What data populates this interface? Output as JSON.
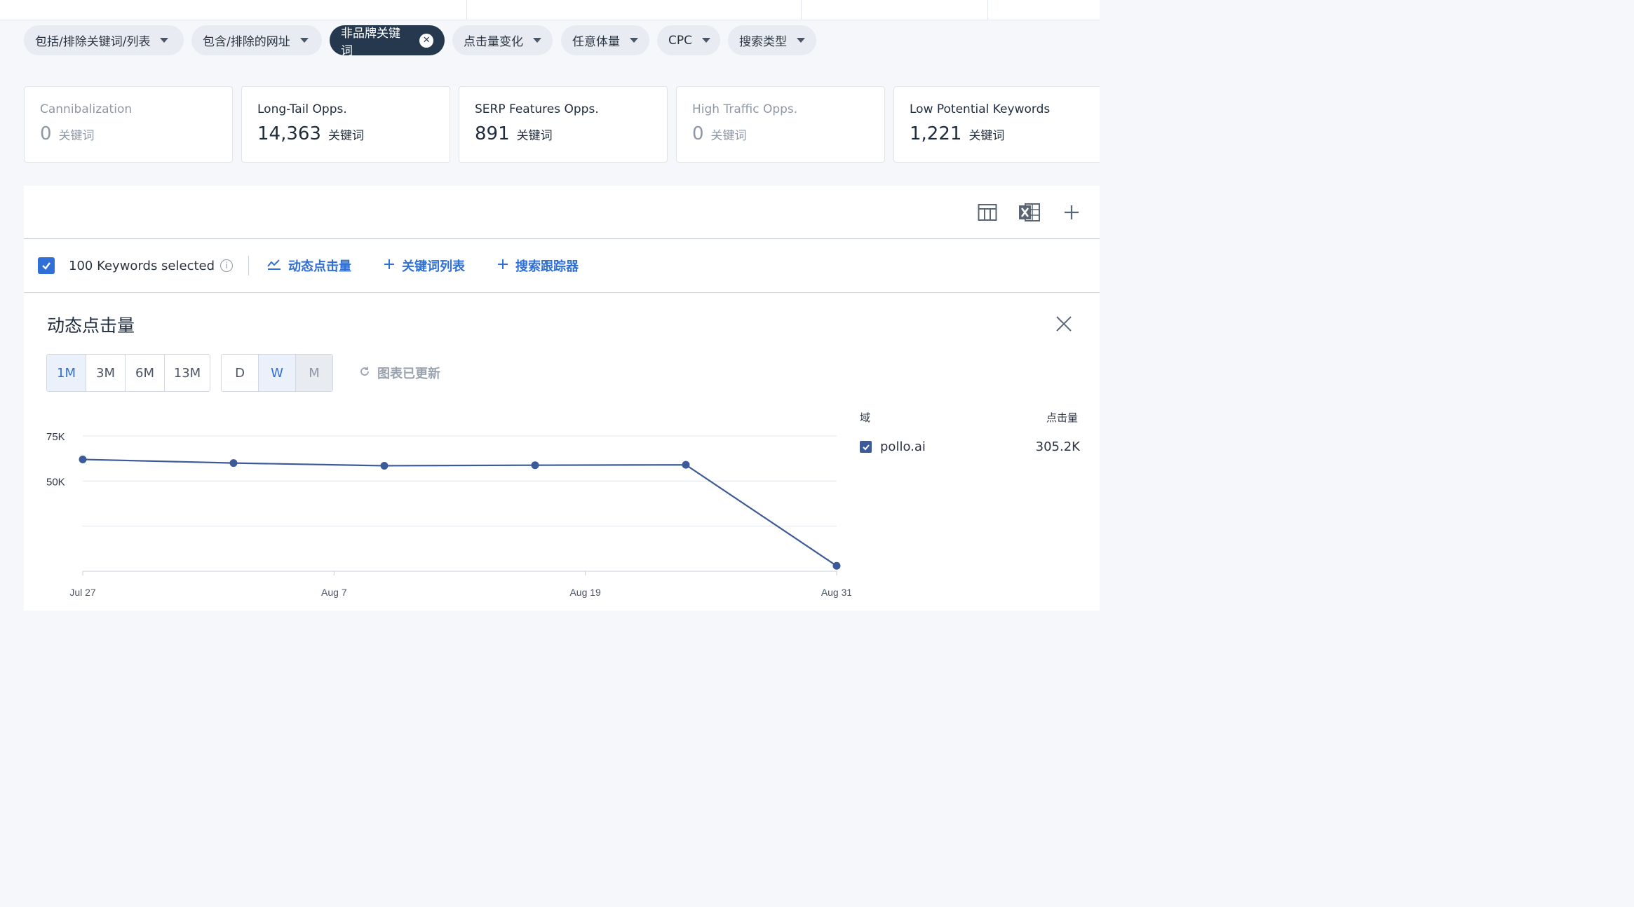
{
  "filters": [
    {
      "label": "包括/排除关键词/列表",
      "active": false
    },
    {
      "label": "包含/排除的网址",
      "active": false
    },
    {
      "label": "非品牌关键词",
      "active": true
    },
    {
      "label": "点击量变化",
      "active": false
    },
    {
      "label": "任意体量",
      "active": false
    },
    {
      "label": "CPC",
      "active": false
    },
    {
      "label": "搜索类型",
      "active": false
    }
  ],
  "cards": [
    {
      "title": "Cannibalization",
      "value": "0",
      "unit": "关键词",
      "muted": true
    },
    {
      "title": "Long-Tail Opps.",
      "value": "14,363",
      "unit": "关键词",
      "muted": false
    },
    {
      "title": "SERP Features Opps.",
      "value": "891",
      "unit": "关键词",
      "muted": false
    },
    {
      "title": "High Traffic Opps.",
      "value": "0",
      "unit": "关键词",
      "muted": true
    },
    {
      "title": "Low Potential Keywords",
      "value": "1,221",
      "unit": "关键词",
      "muted": false
    }
  ],
  "toolbar": {
    "icons": [
      "table-columns-icon",
      "excel-export-icon",
      "plus-icon"
    ]
  },
  "selection": {
    "text": "100 Keywords selected",
    "actions": [
      {
        "label": "动态点击量",
        "icon": "trend-line-icon"
      },
      {
        "label": "关键词列表",
        "icon": "plus-icon"
      },
      {
        "label": "搜索跟踪器",
        "icon": "plus-icon"
      }
    ]
  },
  "chart_panel": {
    "title": "动态点击量",
    "ranges": [
      "1M",
      "3M",
      "6M",
      "13M"
    ],
    "range_selected": "1M",
    "granularity": [
      "D",
      "W",
      "M"
    ],
    "granularity_selected": "W",
    "granularity_disabled": "M",
    "updated_text": "图表已更新",
    "legend": {
      "domain_header": "域",
      "clicks_header": "点击量",
      "items": [
        {
          "name": "pollo.ai",
          "value": "305.2K",
          "checked": true
        }
      ]
    }
  },
  "chart_data": {
    "type": "line",
    "x": [
      "Jul 27",
      "Aug 3",
      "Aug 10",
      "Aug 17",
      "Aug 24",
      "Aug 31"
    ],
    "x_ticks": [
      "Jul 27",
      "Aug 7",
      "Aug 19",
      "Aug 31"
    ],
    "y_ticks": [
      "75K",
      "50K"
    ],
    "series": [
      {
        "name": "pollo.ai",
        "values": [
          62000,
          60000,
          58500,
          58800,
          59000,
          3000
        ]
      }
    ],
    "ylim": [
      0,
      75000
    ],
    "color": "#3c5a9a",
    "grid": true
  }
}
